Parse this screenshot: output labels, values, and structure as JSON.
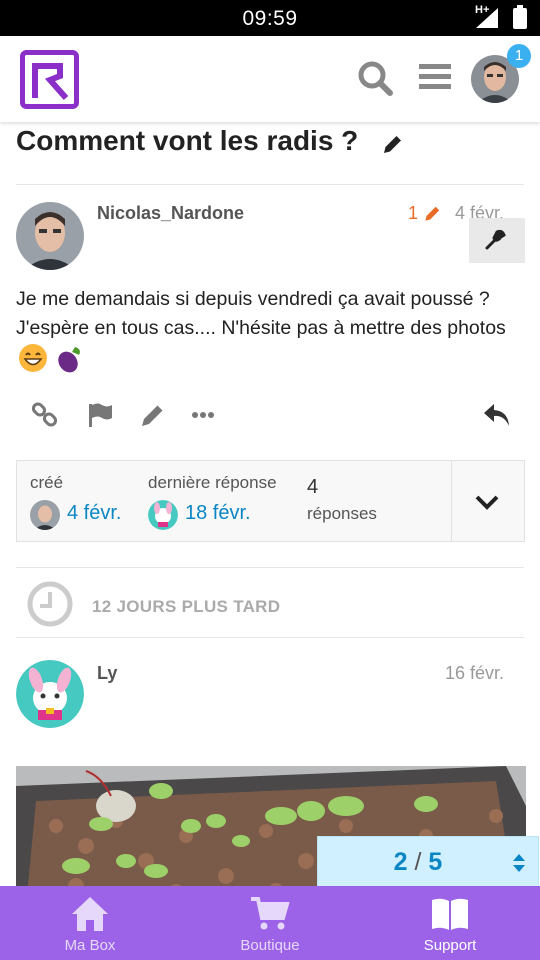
{
  "status_bar": {
    "time": "09:59",
    "network": "H+"
  },
  "header": {
    "notification_count": "1"
  },
  "topic": {
    "title": "Comment vont les radis ?"
  },
  "post1": {
    "username": "Nicolas_Nardone",
    "edit_count": "1",
    "date": "4 févr.",
    "body": "Je me demandais si depuis vendredi ça avait poussé ? J'espère en tous cas.... N'hésite pas à mettre des photos"
  },
  "topic_map": {
    "created_label": "créé",
    "created_date": "4 févr.",
    "last_reply_label": "dernière réponse",
    "last_reply_date": "18 févr.",
    "replies_count": "4",
    "replies_label": "réponses"
  },
  "time_gap": {
    "text": "12 JOURS PLUS TARD"
  },
  "post2": {
    "username": "Ly",
    "date": "16 févr."
  },
  "progress": {
    "current": "2",
    "separator": "/",
    "total": "5"
  },
  "bottom_nav": {
    "items": [
      {
        "label": "Ma Box",
        "icon": "home-icon"
      },
      {
        "label": "Boutique",
        "icon": "cart-icon"
      },
      {
        "label": "Support",
        "icon": "book-icon"
      }
    ],
    "active_index": 2
  },
  "colors": {
    "accent_purple": "#9c63e8",
    "logo_purple": "#8b2fc9",
    "link_blue": "#0a86c5",
    "edit_orange": "#e86c25",
    "progress_bg": "#d1f0ff",
    "badge_blue": "#3ab0f0"
  }
}
